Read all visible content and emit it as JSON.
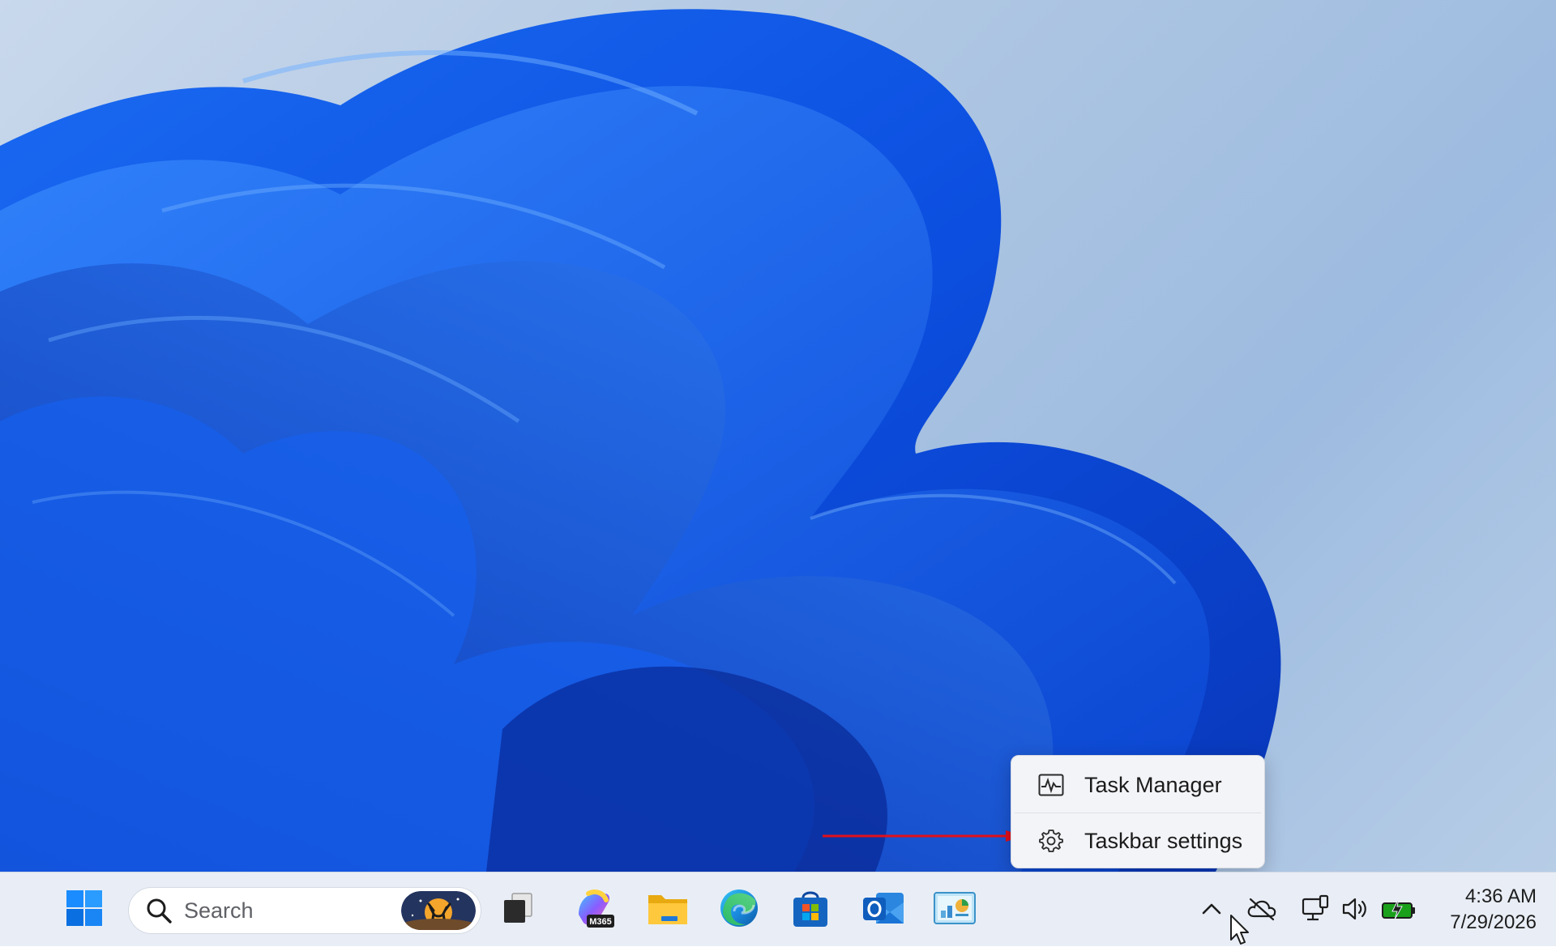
{
  "desktop": {
    "wallpaper": "windows-11-bloom-wallpaper"
  },
  "context_menu": {
    "items": [
      {
        "label": "Task Manager",
        "icon": "task-manager-icon"
      },
      {
        "label": "Taskbar settings",
        "icon": "gear-icon"
      }
    ]
  },
  "annotation": {
    "arrow_color": "#e0101a"
  },
  "taskbar": {
    "start_icon": "windows-start-icon",
    "search": {
      "placeholder": "Search",
      "icon": "search-icon",
      "highlight": "search-highlight-deer-badge"
    },
    "apps": [
      {
        "name": "task-view",
        "icon": "task-view-icon"
      },
      {
        "name": "microsoft-365-copilot",
        "icon": "m365-icon",
        "badge": "M365"
      },
      {
        "name": "file-explorer",
        "icon": "folder-icon"
      },
      {
        "name": "microsoft-edge",
        "icon": "edge-icon"
      },
      {
        "name": "microsoft-store",
        "icon": "store-icon"
      },
      {
        "name": "outlook",
        "icon": "outlook-icon"
      },
      {
        "name": "control-panel",
        "icon": "control-panel-icon"
      }
    ],
    "tray": {
      "overflow_icon": "chevron-up-icon",
      "icons": [
        "onedrive-offline-icon",
        "network-icon",
        "volume-icon",
        "battery-charging-icon"
      ]
    },
    "clock": {
      "time": "4:36 AM",
      "date": "7/29/2026"
    }
  },
  "colors": {
    "accent": "#0067c0",
    "taskbar_bg": "#e9eef6",
    "menu_bg": "#f3f4f8",
    "arrow": "#e0101a",
    "battery": "#1aa01a"
  }
}
